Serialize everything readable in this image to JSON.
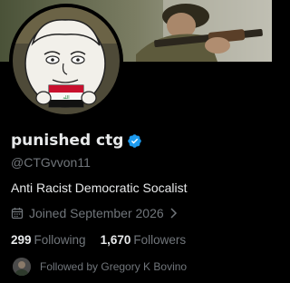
{
  "profile": {
    "display_name": "punished ctg",
    "handle": "@CTGvvon11",
    "bio": "Anti Racist Democratic Socalist",
    "joined": "Joined September 2026",
    "following_count": "299",
    "following_label": "Following",
    "followers_count": "1,670",
    "followers_label": "Followers",
    "followed_by": "Followed by Gregory K Bovino"
  },
  "colors": {
    "background": "#000000",
    "primary_text": "#e7e9ea",
    "secondary_text": "#71767b",
    "verified_badge": "#1d9bf0"
  },
  "icons": {
    "verified": "verified-badge-icon",
    "calendar": "calendar-icon",
    "chevron": "chevron-right-icon"
  }
}
